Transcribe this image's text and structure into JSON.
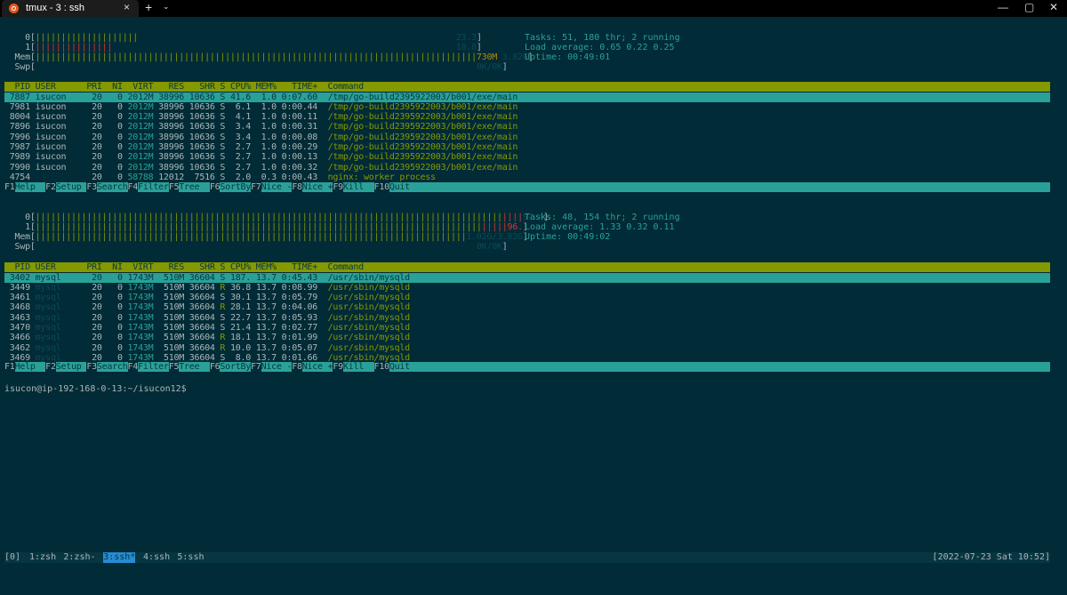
{
  "window": {
    "tab_title": "tmux - 3 : ssh",
    "close_tab": "×",
    "new_tab": "+",
    "tab_menu": "⌄",
    "minimize": "—",
    "maximize": "▢",
    "close": "✕"
  },
  "htop1": {
    "cpu0_label": "0[",
    "cpu0_bars": "||||||||||||||||||||",
    "cpu0_value": "23.3",
    "cpu1_label": "1[",
    "cpu1_bars": "|||||||||||||||",
    "cpu1_value": "18.8",
    "mem_label": "Mem[",
    "mem_bars": "||||||||||||||||||||||||||||||||||||||||||||||||||||||||||||||||||||||||||||||||||||||",
    "mem_value": "730M",
    "mem_total": "3.82G",
    "swp_label": "Swp[",
    "swp_value": "0K/0K",
    "close_bracket": "]",
    "tasks": "Tasks: 51, 180 thr; 2 running",
    "load": "Load average: 0.65 0.22 0.25",
    "uptime": "Uptime: 00:49:01",
    "columns": "  PID USER      PRI  NI  VIRT   RES   SHR S CPU% MEM%   TIME+  Command",
    "rows": [
      {
        "pid": "7887",
        "user": "isucon",
        "pri": "20",
        "ni": "0",
        "virt": "2012M",
        "res": "38996",
        "shr": "10636",
        "s": "S",
        "cpu": "41.6",
        "mem": "1.0",
        "time": "0:07.60",
        "cmd": "/tmp/go-build2395922003/b001/exe/main"
      },
      {
        "pid": "7981",
        "user": "isucon",
        "pri": "20",
        "ni": "0",
        "virt": "2012M",
        "res": "38996",
        "shr": "10636",
        "s": "S",
        "cpu": "6.1",
        "mem": "1.0",
        "time": "0:00.44",
        "cmd": "/tmp/go-build2395922003/b001/exe/main"
      },
      {
        "pid": "8004",
        "user": "isucon",
        "pri": "20",
        "ni": "0",
        "virt": "2012M",
        "res": "38996",
        "shr": "10636",
        "s": "S",
        "cpu": "4.1",
        "mem": "1.0",
        "time": "0:00.11",
        "cmd": "/tmp/go-build2395922003/b001/exe/main"
      },
      {
        "pid": "7896",
        "user": "isucon",
        "pri": "20",
        "ni": "0",
        "virt": "2012M",
        "res": "38996",
        "shr": "10636",
        "s": "S",
        "cpu": "3.4",
        "mem": "1.0",
        "time": "0:00.31",
        "cmd": "/tmp/go-build2395922003/b001/exe/main"
      },
      {
        "pid": "7996",
        "user": "isucon",
        "pri": "20",
        "ni": "0",
        "virt": "2012M",
        "res": "38996",
        "shr": "10636",
        "s": "S",
        "cpu": "3.4",
        "mem": "1.0",
        "time": "0:00.08",
        "cmd": "/tmp/go-build2395922003/b001/exe/main"
      },
      {
        "pid": "7987",
        "user": "isucon",
        "pri": "20",
        "ni": "0",
        "virt": "2012M",
        "res": "38996",
        "shr": "10636",
        "s": "S",
        "cpu": "2.7",
        "mem": "1.0",
        "time": "0:00.29",
        "cmd": "/tmp/go-build2395922003/b001/exe/main"
      },
      {
        "pid": "7989",
        "user": "isucon",
        "pri": "20",
        "ni": "0",
        "virt": "2012M",
        "res": "38996",
        "shr": "10636",
        "s": "S",
        "cpu": "2.7",
        "mem": "1.0",
        "time": "0:00.13",
        "cmd": "/tmp/go-build2395922003/b001/exe/main"
      },
      {
        "pid": "7990",
        "user": "isucon",
        "pri": "20",
        "ni": "0",
        "virt": "2012M",
        "res": "38996",
        "shr": "10636",
        "s": "S",
        "cpu": "2.7",
        "mem": "1.0",
        "time": "0:00.32",
        "cmd": "/tmp/go-build2395922003/b001/exe/main"
      },
      {
        "pid": "4754",
        "user": "",
        "pri": "20",
        "ni": "0",
        "virt": "58788",
        "res": "12012",
        "shr": "7516",
        "s": "S",
        "cpu": "2.0",
        "mem": "0.3",
        "time": "0:00.43",
        "cmd": "nginx: worker process"
      }
    ]
  },
  "htop2": {
    "cpu0_label": "0[",
    "cpu0_bars": "|||||||||||||||||||||||||||||||||||||||||||||||||||||||||||||||||||||||||||||||||||||||||||",
    "cpu0_value": "97.4",
    "cpu1_label": "1[",
    "cpu1_bars": "|||||||||||||||||||||||||||||||||||||||||||||||||||||||||||||||||||||||||||||||||||||||",
    "cpu1_value": "96.",
    "mem_label": "Mem[",
    "mem_bars": "||||||||||||||||||||||||||||||||||||||||||||||||||||||||||||||||||||||||||||||||||||",
    "mem_value": "1.02G/3.82G",
    "swp_label": "Swp[",
    "swp_value": "0K/0K",
    "close_bracket": "]",
    "tasks": "Tasks: 48, 154 thr; 2 running",
    "load": "Load average: 1.33 0.32 0.11",
    "uptime": "Uptime: 00:49:02",
    "columns": "  PID USER      PRI  NI  VIRT   RES   SHR S CPU% MEM%   TIME+  Command",
    "rows": [
      {
        "pid": "3402",
        "user": "mysql",
        "pri": "20",
        "ni": "0",
        "virt": "1743M",
        "res": "510M",
        "shr": "36604",
        "s": "S",
        "cpu": "187.",
        "mem": "13.7",
        "time": "0:45.43",
        "cmd": "/usr/sbin/mysqld"
      },
      {
        "pid": "3449",
        "user": "mysql",
        "pri": "20",
        "ni": "0",
        "virt": "1743M",
        "res": "510M",
        "shr": "36604",
        "s": "R",
        "cpu": "36.8",
        "mem": "13.7",
        "time": "0:08.99",
        "cmd": "/usr/sbin/mysqld"
      },
      {
        "pid": "3461",
        "user": "mysql",
        "pri": "20",
        "ni": "0",
        "virt": "1743M",
        "res": "510M",
        "shr": "36604",
        "s": "S",
        "cpu": "30.1",
        "mem": "13.7",
        "time": "0:05.79",
        "cmd": "/usr/sbin/mysqld"
      },
      {
        "pid": "3468",
        "user": "mysql",
        "pri": "20",
        "ni": "0",
        "virt": "1743M",
        "res": "510M",
        "shr": "36604",
        "s": "R",
        "cpu": "28.1",
        "mem": "13.7",
        "time": "0:04.06",
        "cmd": "/usr/sbin/mysqld"
      },
      {
        "pid": "3463",
        "user": "mysql",
        "pri": "20",
        "ni": "0",
        "virt": "1743M",
        "res": "510M",
        "shr": "36604",
        "s": "S",
        "cpu": "22.7",
        "mem": "13.7",
        "time": "0:05.93",
        "cmd": "/usr/sbin/mysqld"
      },
      {
        "pid": "3470",
        "user": "mysql",
        "pri": "20",
        "ni": "0",
        "virt": "1743M",
        "res": "510M",
        "shr": "36604",
        "s": "S",
        "cpu": "21.4",
        "mem": "13.7",
        "time": "0:02.77",
        "cmd": "/usr/sbin/mysqld"
      },
      {
        "pid": "3466",
        "user": "mysql",
        "pri": "20",
        "ni": "0",
        "virt": "1743M",
        "res": "510M",
        "shr": "36604",
        "s": "R",
        "cpu": "18.1",
        "mem": "13.7",
        "time": "0:01.99",
        "cmd": "/usr/sbin/mysqld"
      },
      {
        "pid": "3462",
        "user": "mysql",
        "pri": "20",
        "ni": "0",
        "virt": "1743M",
        "res": "510M",
        "shr": "36604",
        "s": "R",
        "cpu": "10.0",
        "mem": "13.7",
        "time": "0:05.07",
        "cmd": "/usr/sbin/mysqld"
      },
      {
        "pid": "3469",
        "user": "mysql",
        "pri": "20",
        "ni": "0",
        "virt": "1743M",
        "res": "510M",
        "shr": "36604",
        "s": "S",
        "cpu": "8.0",
        "mem": "13.7",
        "time": "0:01.66",
        "cmd": "/usr/sbin/mysqld"
      }
    ]
  },
  "fkeys": [
    {
      "key": "F1",
      "label": "Help  "
    },
    {
      "key": "F2",
      "label": "Setup "
    },
    {
      "key": "F3",
      "label": "Search"
    },
    {
      "key": "F4",
      "label": "Filter"
    },
    {
      "key": "F5",
      "label": "Tree  "
    },
    {
      "key": "F6",
      "label": "SortBy"
    },
    {
      "key": "F7",
      "label": "Nice -"
    },
    {
      "key": "F8",
      "label": "Nice +"
    },
    {
      "key": "F9",
      "label": "Kill  "
    },
    {
      "key": "F10",
      "label": "Quit  "
    }
  ],
  "prompt": "isucon@ip-192-168-0-13:~/isucon12$",
  "tmux": {
    "session": "[0]",
    "windows": [
      "1:zsh",
      "2:zsh-",
      "3:ssh*",
      "4:ssh",
      "5:ssh"
    ],
    "active_index": 2,
    "clock": "[2022-07-23 Sat 10:52]"
  },
  "colors": {
    "background": "#012b36",
    "header_bar": "#859900",
    "selection": "#2aa198",
    "status_bar": "#073642"
  }
}
